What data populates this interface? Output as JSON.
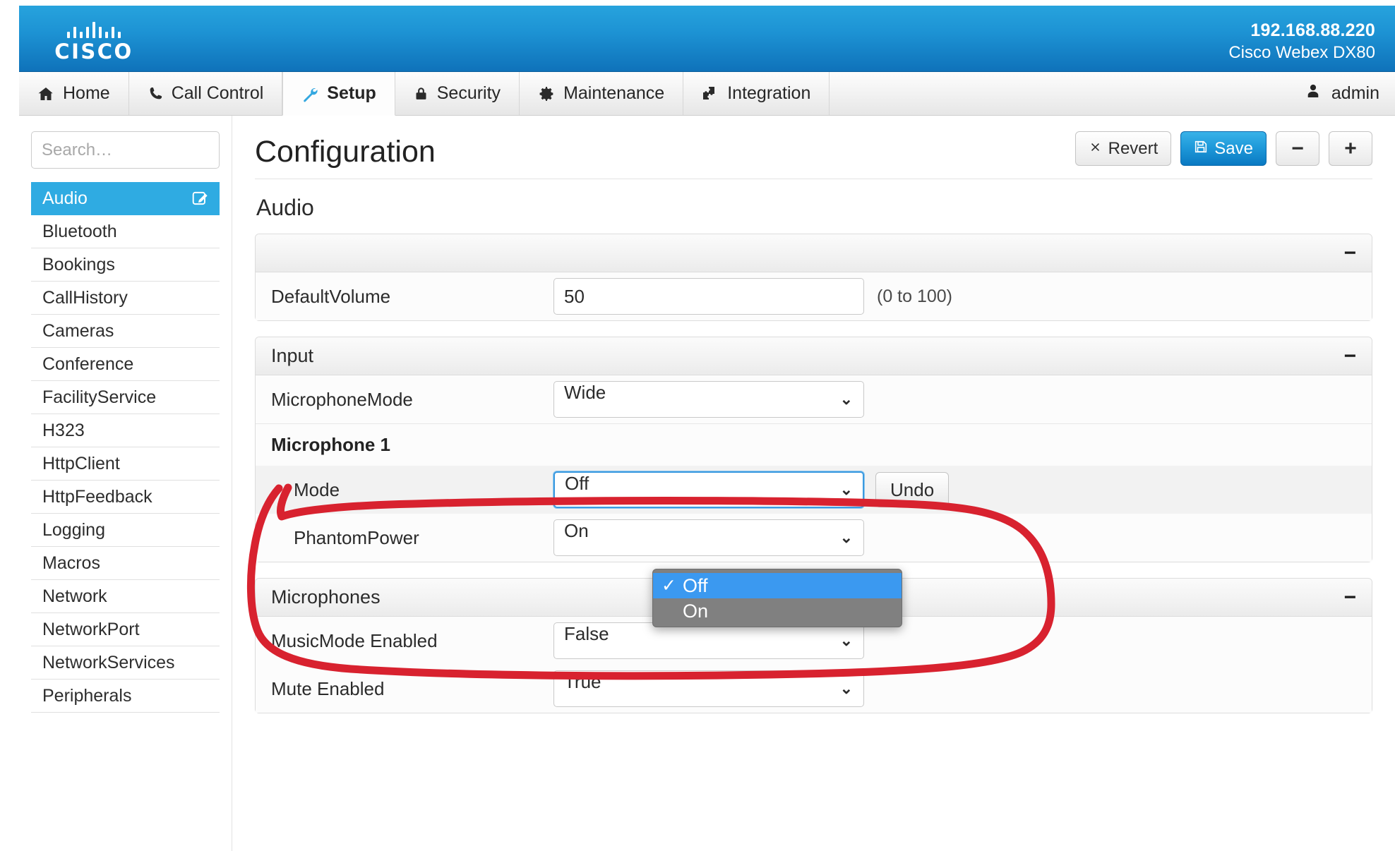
{
  "banner": {
    "logo_text": "CISCO",
    "ip_address": "192.168.88.220",
    "model": "Cisco Webex DX80"
  },
  "nav": {
    "tabs": [
      {
        "label": "Home",
        "icon": "home-icon",
        "active": false
      },
      {
        "label": "Call Control",
        "icon": "phone-icon",
        "active": false
      },
      {
        "label": "Setup",
        "icon": "wrench-icon",
        "active": true
      },
      {
        "label": "Security",
        "icon": "lock-icon",
        "active": false
      },
      {
        "label": "Maintenance",
        "icon": "gear-icon",
        "active": false
      },
      {
        "label": "Integration",
        "icon": "puzzle-icon",
        "active": false
      }
    ],
    "user": "admin",
    "user_icon": "person-icon"
  },
  "sidebar": {
    "search_placeholder": "Search…",
    "search_value": "",
    "items": [
      {
        "label": "Audio",
        "active": true,
        "icon": "edit-pencil-icon"
      },
      {
        "label": "Bluetooth",
        "active": false
      },
      {
        "label": "Bookings",
        "active": false
      },
      {
        "label": "CallHistory",
        "active": false
      },
      {
        "label": "Cameras",
        "active": false
      },
      {
        "label": "Conference",
        "active": false
      },
      {
        "label": "FacilityService",
        "active": false
      },
      {
        "label": "H323",
        "active": false
      },
      {
        "label": "HttpClient",
        "active": false
      },
      {
        "label": "HttpFeedback",
        "active": false
      },
      {
        "label": "Logging",
        "active": false
      },
      {
        "label": "Macros",
        "active": false
      },
      {
        "label": "Network",
        "active": false
      },
      {
        "label": "NetworkPort",
        "active": false
      },
      {
        "label": "NetworkServices",
        "active": false
      },
      {
        "label": "Peripherals",
        "active": false
      }
    ]
  },
  "main": {
    "title": "Configuration",
    "buttons": {
      "revert": "Revert",
      "revert_icon": "x-icon",
      "save": "Save",
      "save_icon": "floppy-disk-icon",
      "collapse_all": "−",
      "expand_all": "+"
    },
    "section_heading": "Audio",
    "panels": [
      {
        "title": "",
        "collapse_icon": "−",
        "rows": [
          {
            "label": "DefaultVolume",
            "control": "text",
            "value": "50",
            "hint": "(0 to 100)"
          }
        ]
      },
      {
        "title": "Input",
        "collapse_icon": "−",
        "rows": [
          {
            "label": "MicrophoneMode",
            "control": "select",
            "value": "Wide",
            "hint": ""
          }
        ],
        "subgroup": {
          "title": "Microphone 1",
          "rows": [
            {
              "label": "Mode",
              "control": "select",
              "value": "Off",
              "undo_label": "Undo",
              "focused": true
            },
            {
              "label": "PhantomPower",
              "control": "select",
              "value": "On"
            }
          ]
        }
      },
      {
        "title": "Microphones",
        "collapse_icon": "−",
        "rows": [
          {
            "label": "MusicMode Enabled",
            "control": "select",
            "value": "False"
          },
          {
            "label": "Mute Enabled",
            "control": "select",
            "value": "True"
          }
        ]
      }
    ],
    "open_dropdown": {
      "for_field": "Mode",
      "check_glyph": "✓",
      "options": [
        {
          "label": "Off",
          "selected": true
        },
        {
          "label": "On",
          "selected": false
        }
      ]
    }
  },
  "annotation": {
    "type": "hand-drawn-ellipse",
    "color": "#d8222f",
    "target": "Microphone 1 group"
  }
}
